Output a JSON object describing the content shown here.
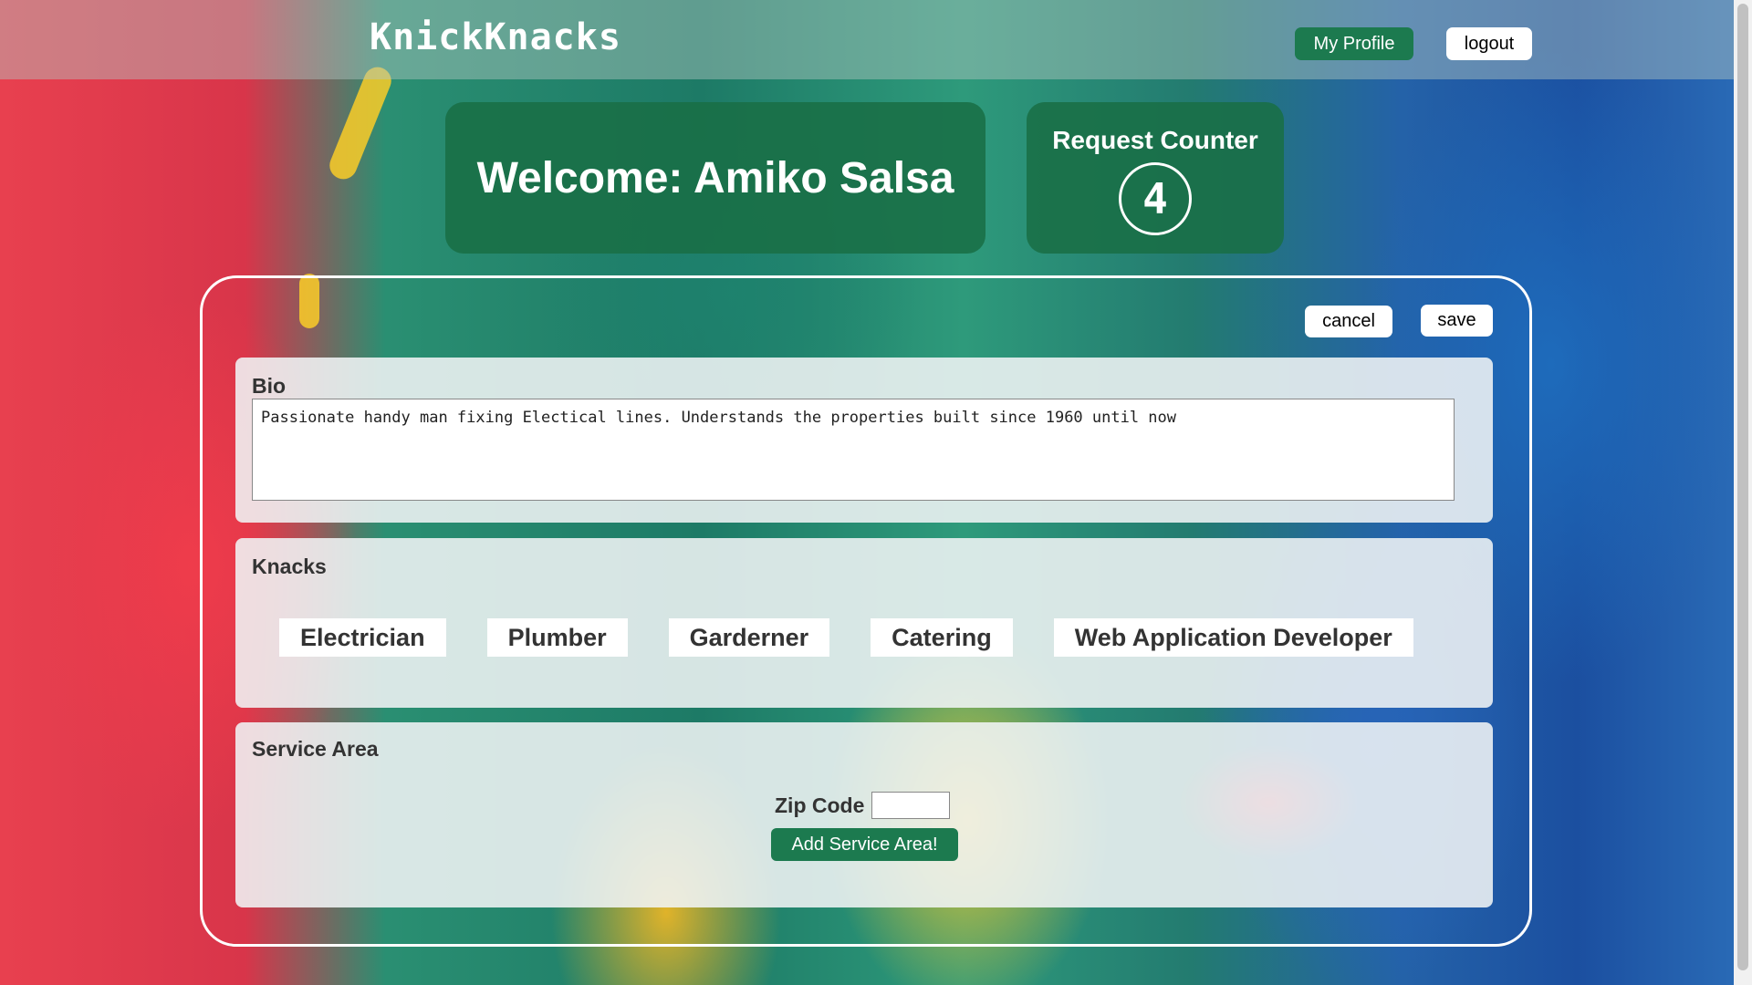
{
  "header": {
    "logo": "KnickKnacks",
    "my_profile_label": "My Profile",
    "logout_label": "logout"
  },
  "welcome": {
    "text": "Welcome: Amiko Salsa"
  },
  "request_counter": {
    "title": "Request Counter",
    "count": "4"
  },
  "actions": {
    "cancel_label": "cancel",
    "save_label": "save"
  },
  "bio": {
    "title": "Bio",
    "value": "Passionate handy man fixing Electical lines. Understands the properties built since 1960 until now"
  },
  "knacks": {
    "title": "Knacks",
    "items": [
      "Electrician",
      "Plumber",
      "Garderner",
      "Catering",
      "Web Application Developer"
    ]
  },
  "service_area": {
    "title": "Service Area",
    "zip_label": "Zip Code",
    "zip_value": "",
    "add_button_label": "Add Service Area!"
  },
  "colors": {
    "brand_green": "#1c7a4f",
    "card_green": "#196e46"
  }
}
